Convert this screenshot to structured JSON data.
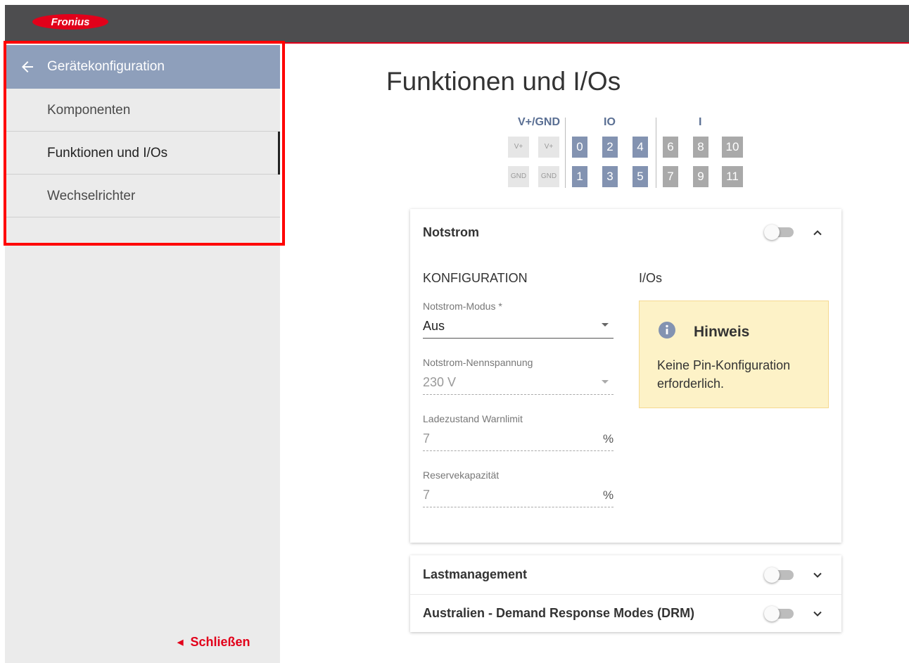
{
  "brand": {
    "logo_text": "Fronius",
    "accent": "#e2001a",
    "topbar_color": "#4d4d4f"
  },
  "sidebar": {
    "header": {
      "back_icon": "arrow-left-icon",
      "title": "Gerätekonfiguration",
      "color": "#8e9fbb"
    },
    "items": [
      {
        "label": "Komponenten",
        "active": false
      },
      {
        "label": "Funktionen und I/Os",
        "active": true
      },
      {
        "label": "Wechselrichter",
        "active": false
      }
    ],
    "close_label": "Schließen"
  },
  "main": {
    "title": "Funktionen und I/Os",
    "pins": {
      "groups": [
        {
          "label": "V+/GND"
        },
        {
          "label": "IO"
        },
        {
          "label": "I"
        }
      ],
      "power_top": [
        "V+",
        "V+"
      ],
      "power_bottom": [
        "GND",
        "GND"
      ],
      "io_top": [
        "0",
        "2",
        "4"
      ],
      "io_bottom": [
        "1",
        "3",
        "5"
      ],
      "in_top": [
        "6",
        "8",
        "10"
      ],
      "in_bottom": [
        "7",
        "9",
        "11"
      ]
    },
    "notstrom": {
      "title": "Notstrom",
      "enabled": false,
      "expanded": true,
      "config_heading": "KONFIGURATION",
      "ios_heading": "I/Os",
      "fields": {
        "modus": {
          "label": "Notstrom-Modus *",
          "value": "Aus"
        },
        "nennspannung": {
          "label": "Notstrom-Nennspannung",
          "value": "230 V"
        },
        "warnlimit": {
          "label": "Ladezustand Warnlimit",
          "value": "7",
          "unit": "%"
        },
        "reserve": {
          "label": "Reservekapazität",
          "value": "7",
          "unit": "%"
        }
      },
      "hint": {
        "icon": "info-icon",
        "title": "Hinweis",
        "text": "Keine Pin-Konfiguration erforderlich."
      }
    },
    "lastmanagement": {
      "title": "Lastmanagement",
      "enabled": false,
      "expanded": false
    },
    "drm": {
      "title": "Australien - Demand Response Modes (DRM)",
      "enabled": false,
      "expanded": false
    }
  }
}
